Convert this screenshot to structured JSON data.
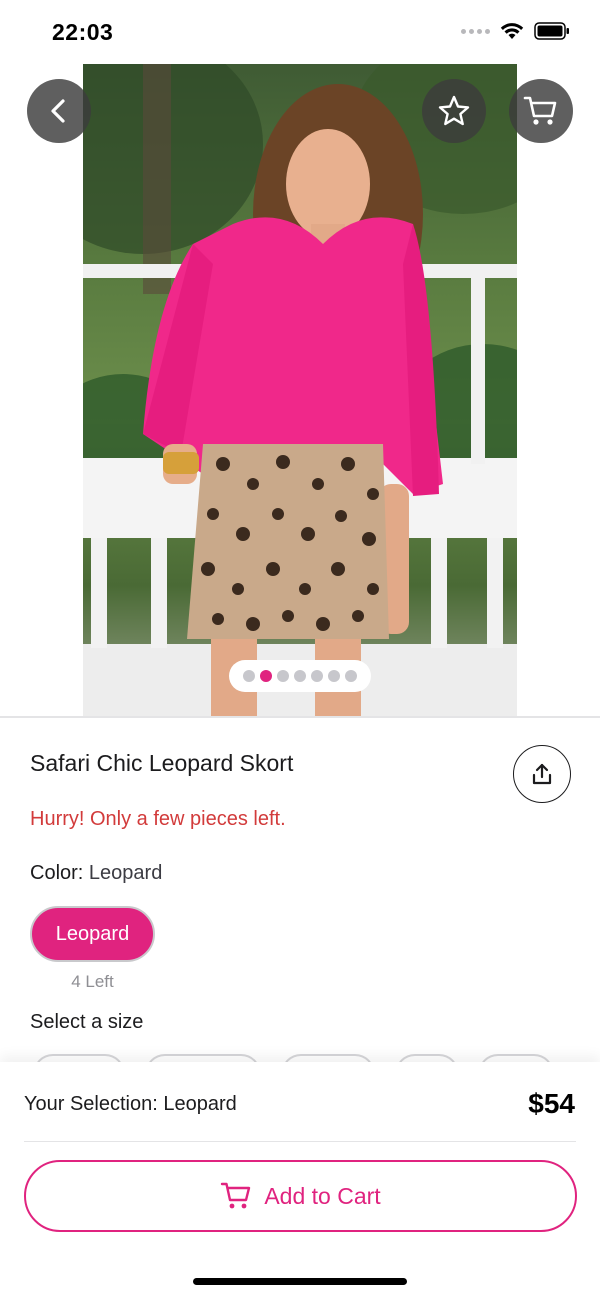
{
  "status_bar": {
    "time": "22:03"
  },
  "product": {
    "title": "Safari Chic Leopard Skort",
    "stock_warning": "Hurry! Only a few pieces left.",
    "color_label": "Color:",
    "color_value": "Leopard",
    "color_options": [
      {
        "label": "Leopard",
        "left_text": "4 Left",
        "selected": true
      }
    ],
    "size_label": "Select a size",
    "image_pager": {
      "count": 7,
      "active_index": 1
    }
  },
  "bottom_bar": {
    "selection_text": "Your Selection: Leopard",
    "price": "$54",
    "add_to_cart_label": "Add to Cart"
  },
  "colors": {
    "accent": "#e0237f",
    "warning": "#d23b3b",
    "overlay_button": "#3c3c3c"
  },
  "icons": [
    "back-icon",
    "star-icon",
    "cart-icon",
    "share-icon",
    "add-cart-icon",
    "wifi-icon",
    "battery-icon"
  ]
}
